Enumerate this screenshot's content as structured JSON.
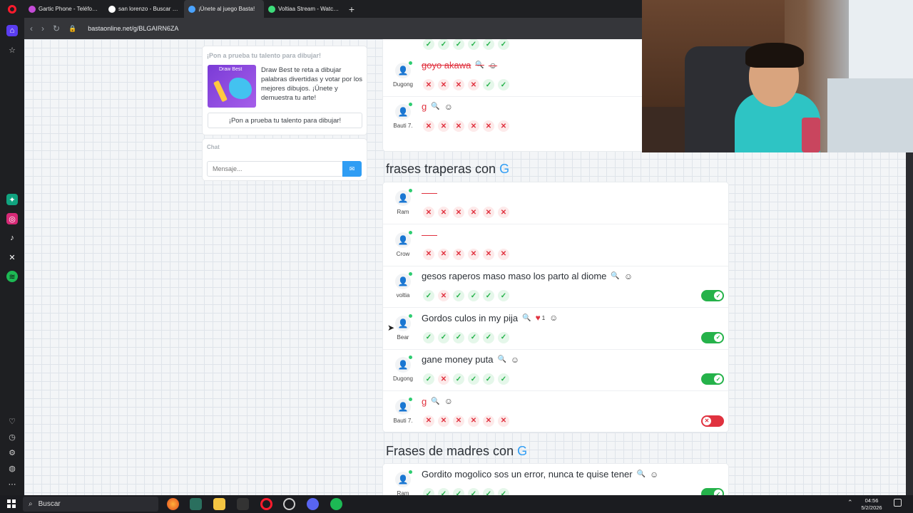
{
  "tabs": [
    {
      "label": "Gartic Phone - Teléfono D",
      "color": "#c44bd6"
    },
    {
      "label": "san lorenzo - Buscar con G",
      "color": "#ffffff"
    },
    {
      "label": "¡Únete al juego Basta!",
      "color": "#4aa3ff"
    },
    {
      "label": "Voltiaa Stream - Watch Li",
      "color": "#3ddc7a"
    }
  ],
  "url": "bastaonline.net/g/BLGAIRN6ZA",
  "promo": {
    "heading": "¡Pon a prueba tu talento para dibujar!",
    "thumb_title": "Draw Best",
    "description": "Draw Best te reta a dibujar palabras divertidas y votar por los mejores dibujos. ¡Únete y demuestra tu arte!",
    "button": "¡Pon a prueba tu talento para dibujar!"
  },
  "chat": {
    "heading": "Chat",
    "placeholder": "Mensaje..."
  },
  "top_rows": [
    {
      "user": "Dugong",
      "answer": "goyo akawa",
      "style": "struck",
      "votes": [
        "no",
        "no",
        "no",
        "no",
        "ok",
        "ok"
      ]
    },
    {
      "user": "Bauti 7.",
      "answer": "g",
      "style": "red",
      "votes": [
        "no",
        "no",
        "no",
        "no",
        "no",
        "no"
      ]
    }
  ],
  "sections": [
    {
      "title": "frases traperas con",
      "letter": "G",
      "rows": [
        {
          "user": "Ram",
          "answer": "",
          "style": "empty",
          "votes": [
            "no",
            "no",
            "no",
            "no",
            "no",
            "no"
          ],
          "toggle": ""
        },
        {
          "user": "Crow",
          "answer": "",
          "style": "empty",
          "votes": [
            "no",
            "no",
            "no",
            "no",
            "no",
            "no"
          ],
          "toggle": ""
        },
        {
          "user": "voltia",
          "answer": "gesos raperos maso maso los parto al diome",
          "style": "normal",
          "votes": [
            "ok",
            "no",
            "ok",
            "ok",
            "ok",
            "ok"
          ],
          "toggle": "on"
        },
        {
          "user": "Bear",
          "answer": "Gordos culos in my pija",
          "style": "normal",
          "votes": [
            "ok",
            "ok",
            "ok",
            "ok",
            "ok",
            "ok"
          ],
          "toggle": "on",
          "likes": "1"
        },
        {
          "user": "Dugong",
          "answer": "gane money puta",
          "style": "normal",
          "votes": [
            "ok",
            "no",
            "ok",
            "ok",
            "ok",
            "ok"
          ],
          "toggle": "on"
        },
        {
          "user": "Bauti 7.",
          "answer": "g",
          "style": "red",
          "votes": [
            "no",
            "no",
            "no",
            "no",
            "no",
            "no"
          ],
          "toggle": "off"
        }
      ]
    },
    {
      "title": "Frases de madres con",
      "letter": "G",
      "rows": [
        {
          "user": "Ram",
          "answer": "Gordito mogolico sos un error, nunca te quise tener",
          "style": "normal",
          "votes": [
            "ok",
            "ok",
            "ok",
            "ok",
            "ok",
            "ok"
          ],
          "toggle": "on"
        }
      ]
    }
  ],
  "taskbar": {
    "search": "Buscar",
    "time": "04:56",
    "date": "5/2/2026"
  },
  "colors": {
    "accent": "#2f9df4",
    "ok": "#25b24a",
    "bad": "#e0323f"
  }
}
